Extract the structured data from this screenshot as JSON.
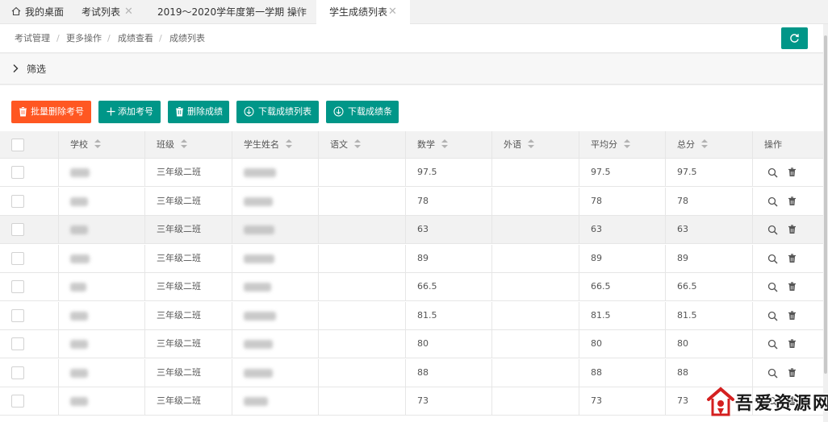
{
  "tabs": [
    {
      "label": "我的桌面",
      "closable": false,
      "active": false
    },
    {
      "label": "考试列表",
      "closable": true,
      "active": false
    },
    {
      "label": "2019～2020学年度第一学期 操作",
      "closable": true,
      "active": false
    },
    {
      "label": "学生成绩列表",
      "closable": true,
      "active": true
    }
  ],
  "tab_close_glyph": "✕",
  "breadcrumb": [
    "考试管理",
    "更多操作",
    "成绩查看",
    "成绩列表"
  ],
  "breadcrumb_separator": "/",
  "filter": {
    "label": "筛选"
  },
  "toolbar": {
    "batch_delete": "批量删除考号",
    "add_number": "添加考号",
    "delete_scores": "删除成绩",
    "download_list": "下载成绩列表",
    "download_slips": "下载成绩条"
  },
  "table": {
    "headers": {
      "school": "学校",
      "class": "班级",
      "name": "学生姓名",
      "chinese": "语文",
      "math": "数学",
      "foreign": "外语",
      "average": "平均分",
      "total": "总分",
      "actions": "操作"
    },
    "rows": [
      {
        "class": "三年级二班",
        "chinese": "",
        "math": "97.5",
        "foreign": "",
        "average": "97.5",
        "total": "97.5"
      },
      {
        "class": "三年级二班",
        "chinese": "",
        "math": "78",
        "foreign": "",
        "average": "78",
        "total": "78"
      },
      {
        "class": "三年级二班",
        "chinese": "",
        "math": "63",
        "foreign": "",
        "average": "63",
        "total": "63"
      },
      {
        "class": "三年级二班",
        "chinese": "",
        "math": "89",
        "foreign": "",
        "average": "89",
        "total": "89"
      },
      {
        "class": "三年级二班",
        "chinese": "",
        "math": "66.5",
        "foreign": "",
        "average": "66.5",
        "total": "66.5"
      },
      {
        "class": "三年级二班",
        "chinese": "",
        "math": "81.5",
        "foreign": "",
        "average": "81.5",
        "total": "81.5"
      },
      {
        "class": "三年级二班",
        "chinese": "",
        "math": "80",
        "foreign": "",
        "average": "80",
        "total": "80"
      },
      {
        "class": "三年级二班",
        "chinese": "",
        "math": "88",
        "foreign": "",
        "average": "88",
        "total": "88"
      },
      {
        "class": "三年级二班",
        "chinese": "",
        "math": "73",
        "foreign": "",
        "average": "73",
        "total": "73"
      }
    ]
  },
  "watermark": {
    "text": "吾爱资源网"
  },
  "colors": {
    "primary": "#009688",
    "danger": "#ff5722",
    "border": "#e6e6e6",
    "header_bg": "#f2f2f2"
  },
  "icons": {
    "home": "home-icon",
    "refresh": "refresh-icon",
    "filter_toggle": "chevron-right-icon",
    "trash": "trash-icon",
    "plus": "plus-icon",
    "download": "download-circle-icon",
    "view": "search-icon"
  }
}
